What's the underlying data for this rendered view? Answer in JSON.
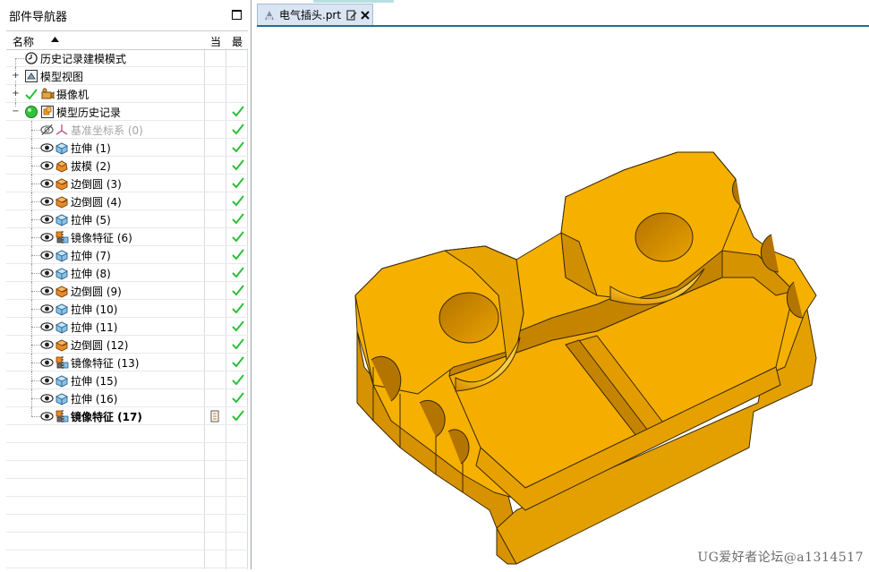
{
  "navigator": {
    "title": "部件导航器",
    "columns": {
      "name": "名称",
      "current": "当",
      "latest": "最"
    },
    "rows": [
      {
        "label": "历史记录建模模式",
        "icon": "clock-icon",
        "level": 0,
        "expander": "",
        "check": false,
        "style": "normal"
      },
      {
        "label": "模型视图",
        "icon": "model-views-icon",
        "level": 0,
        "expander": "+",
        "check": false,
        "style": "normal"
      },
      {
        "label": "摄像机",
        "icon": "camera-icon",
        "level": 0,
        "expander": "+",
        "check": false,
        "pre_check": true,
        "style": "normal"
      },
      {
        "label": "模型历史记录",
        "icon": "model-history-icon",
        "level": 0,
        "expander": "−",
        "check": true,
        "green_ball": true,
        "style": "normal"
      },
      {
        "label": "基准坐标系 (0)",
        "icon": "datum-csys-icon",
        "level": 1,
        "check": true,
        "hidden": true,
        "style": "gray"
      },
      {
        "label": "拉伸 (1)",
        "icon": "extrude-icon",
        "level": 1,
        "check": true,
        "style": "normal"
      },
      {
        "label": "拔模 (2)",
        "icon": "draft-icon",
        "level": 1,
        "check": true,
        "style": "normal"
      },
      {
        "label": "边倒圆 (3)",
        "icon": "edge-blend-icon",
        "level": 1,
        "check": true,
        "style": "normal"
      },
      {
        "label": "边倒圆 (4)",
        "icon": "edge-blend-icon",
        "level": 1,
        "check": true,
        "style": "normal"
      },
      {
        "label": "拉伸 (5)",
        "icon": "extrude-icon",
        "level": 1,
        "check": true,
        "style": "normal"
      },
      {
        "label": "镜像特征 (6)",
        "icon": "mirror-feature-icon",
        "level": 1,
        "check": true,
        "style": "normal"
      },
      {
        "label": "拉伸 (7)",
        "icon": "extrude-icon",
        "level": 1,
        "check": true,
        "style": "normal"
      },
      {
        "label": "拉伸 (8)",
        "icon": "extrude-icon",
        "level": 1,
        "check": true,
        "style": "normal"
      },
      {
        "label": "边倒圆 (9)",
        "icon": "edge-blend-icon",
        "level": 1,
        "check": true,
        "style": "normal"
      },
      {
        "label": "拉伸 (10)",
        "icon": "extrude-icon",
        "level": 1,
        "check": true,
        "style": "normal"
      },
      {
        "label": "拉伸 (11)",
        "icon": "extrude-icon",
        "level": 1,
        "check": true,
        "style": "normal"
      },
      {
        "label": "边倒圆 (12)",
        "icon": "edge-blend-icon",
        "level": 1,
        "check": true,
        "style": "normal"
      },
      {
        "label": "镜像特征 (13)",
        "icon": "mirror-feature-icon",
        "level": 1,
        "check": true,
        "style": "normal"
      },
      {
        "label": "拉伸 (15)",
        "icon": "extrude-icon",
        "level": 1,
        "check": true,
        "style": "normal"
      },
      {
        "label": "拉伸 (16)",
        "icon": "extrude-icon",
        "level": 1,
        "check": true,
        "style": "normal"
      },
      {
        "label": "镜像特征 (17)",
        "icon": "mirror-feature-icon",
        "level": 1,
        "check": true,
        "style": "bold",
        "current_marker": true
      }
    ]
  },
  "document_tab": {
    "title": "电气插头.prt"
  },
  "watermark": "UG爱好者论坛@a1314517",
  "colors": {
    "part_face": "#f6b000",
    "part_dark": "#c98700",
    "check_green": "#2bbf3a",
    "tab_accent": "#1f6f93"
  }
}
